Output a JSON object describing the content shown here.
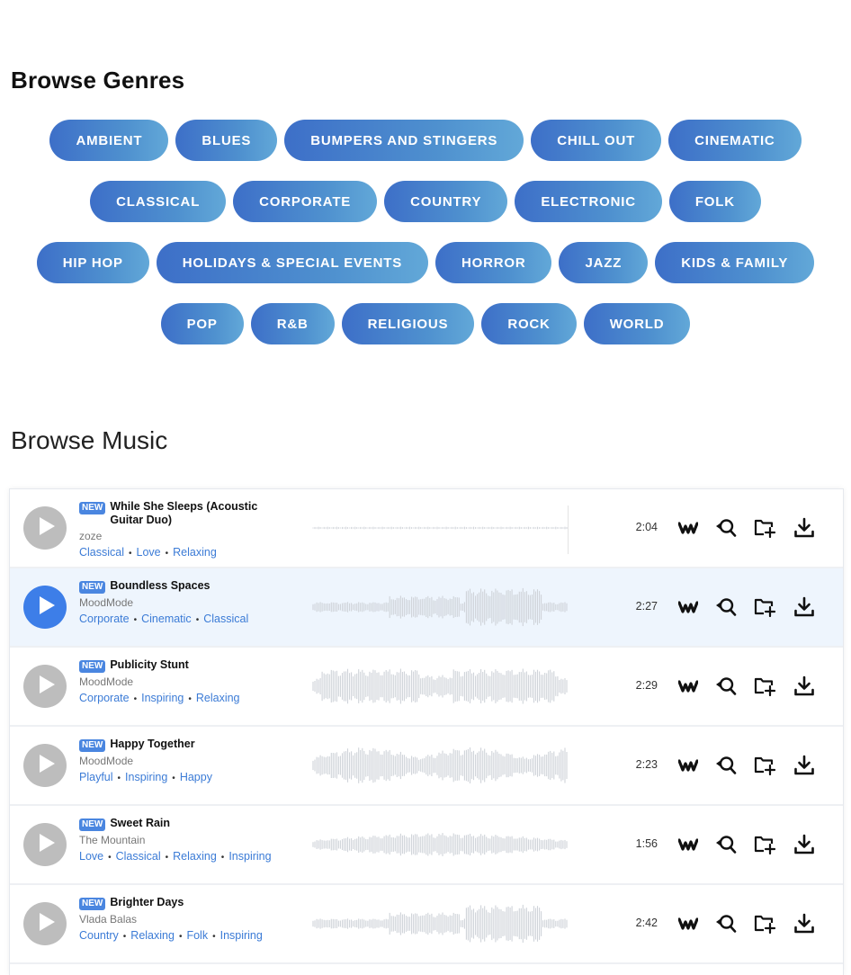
{
  "genres": {
    "title": "Browse Genres",
    "rows": [
      [
        "AMBIENT",
        "BLUES",
        "BUMPERS AND STINGERS",
        "CHILL OUT",
        "CINEMATIC"
      ],
      [
        "CLASSICAL",
        "CORPORATE",
        "COUNTRY",
        "ELECTRONIC",
        "FOLK"
      ],
      [
        "HIP HOP",
        "HOLIDAYS & SPECIAL EVENTS",
        "HORROR",
        "JAZZ",
        "KIDS & FAMILY"
      ],
      [
        "POP",
        "R&B",
        "RELIGIOUS",
        "ROCK",
        "WORLD"
      ]
    ]
  },
  "music": {
    "title": "Browse Music",
    "badge": "NEW",
    "tracks": [
      {
        "title": "While She Sleeps (Acoustic Guitar Duo)",
        "artist": "zoze",
        "tags": [
          "Classical",
          "Love",
          "Relaxing"
        ],
        "duration": "2:04",
        "active": false,
        "wave": "flat"
      },
      {
        "title": "Boundless Spaces",
        "artist": "MoodMode",
        "tags": [
          "Corporate",
          "Cinematic",
          "Classical"
        ],
        "duration": "2:27",
        "active": true,
        "wave": "build"
      },
      {
        "title": "Publicity Stunt",
        "artist": "MoodMode",
        "tags": [
          "Corporate",
          "Inspiring",
          "Relaxing"
        ],
        "duration": "2:29",
        "active": false,
        "wave": "full"
      },
      {
        "title": "Happy Together",
        "artist": "MoodMode",
        "tags": [
          "Playful",
          "Inspiring",
          "Happy"
        ],
        "duration": "2:23",
        "active": false,
        "wave": "wavy"
      },
      {
        "title": "Sweet Rain",
        "artist": "The Mountain",
        "tags": [
          "Love",
          "Classical",
          "Relaxing",
          "Inspiring"
        ],
        "duration": "1:56",
        "active": false,
        "wave": "soft"
      },
      {
        "title": "Brighter Days",
        "artist": "Vlada Balas",
        "tags": [
          "Country",
          "Relaxing",
          "Folk",
          "Inspiring"
        ],
        "duration": "2:42",
        "active": false,
        "wave": "build"
      }
    ]
  },
  "colors": {
    "accent": "#3d7ee8",
    "tag": "#3b7bd6",
    "waveform": "#cfd3d9",
    "play_idle": "#bdbdbd"
  },
  "icons": {
    "play": "play-icon",
    "logo": "wm-logo-icon",
    "similar": "similar-search-icon",
    "folder": "add-to-folder-icon",
    "download": "download-icon"
  }
}
